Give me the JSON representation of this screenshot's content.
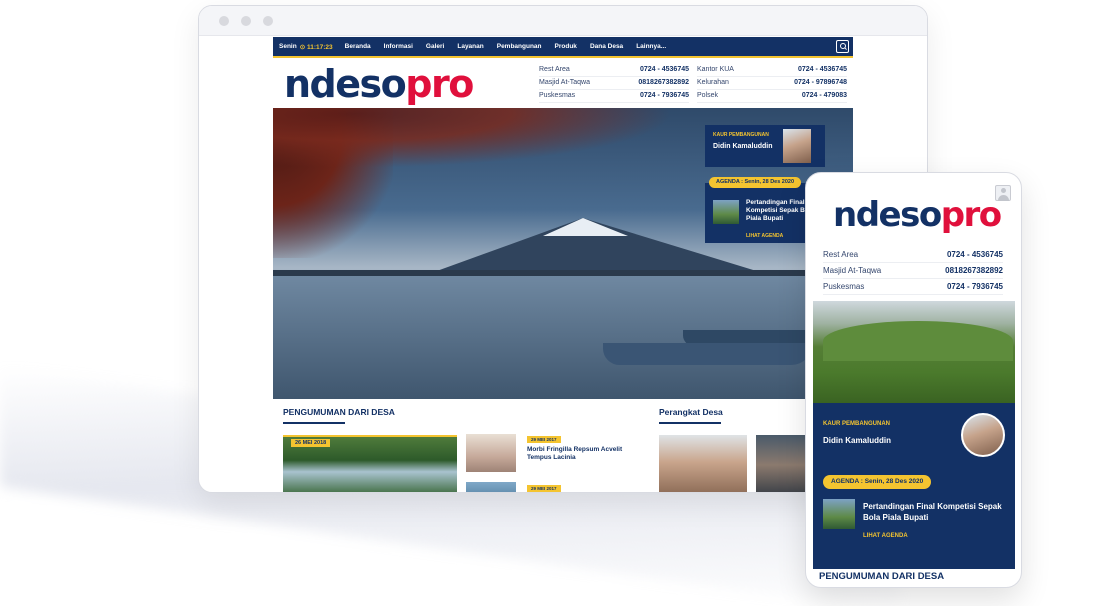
{
  "nav": {
    "day": "Senin",
    "time": "11:17:23",
    "items": [
      "Beranda",
      "Informasi",
      "Galeri",
      "Layanan",
      "Pembangunan",
      "Produk",
      "Dana Desa",
      "Lainnya..."
    ]
  },
  "logo": {
    "part1": "ndeso",
    "part2": "pro"
  },
  "contacts": [
    {
      "name": "Rest Area",
      "phone": "0724 - 4536745"
    },
    {
      "name": "Kantor KUA",
      "phone": "0724 - 4536745"
    },
    {
      "name": "Masjid At-Taqwa",
      "phone": "0818267382892"
    },
    {
      "name": "Kelurahan",
      "phone": "0724 - 97896748"
    },
    {
      "name": "Puskesmas",
      "phone": "0724 - 7936745"
    },
    {
      "name": "Polsek",
      "phone": "0724 - 479083"
    }
  ],
  "kaur": {
    "label": "KAUR PEMBANGUNAN",
    "name": "Didin Kamaluddin"
  },
  "agenda": {
    "badge": "AGENDA : Senin, 28 Des 2020",
    "title_desktop": "Pertandingan Final Kompetisi Sepak B... Piala Bupati",
    "title_mobile": "Pertandingan Final Kompetisi Sepak Bola Piala Bupati",
    "link": "LIHAT AGENDA"
  },
  "sections": {
    "pengumuman": "PENGUMUMAN DARI DESA",
    "perangkat": "Perangkat Desa"
  },
  "announcements": {
    "main_date": "26 MEI 2018",
    "item1_date": "29 MEI 2017",
    "item1_title": "Morbi Fringilla Repsum Acvelit Tempus Lacinia",
    "item2_date": "29 MEI 2017"
  },
  "mobile_contacts": [
    {
      "name": "Rest Area",
      "phone": "0724 - 4536745"
    },
    {
      "name": "Masjid At-Taqwa",
      "phone": "0818267382892"
    },
    {
      "name": "Puskesmas",
      "phone": "0724 - 7936745"
    }
  ],
  "colors": {
    "navy": "#133165",
    "accent": "#f4c430",
    "brand_red": "#e0103c"
  }
}
